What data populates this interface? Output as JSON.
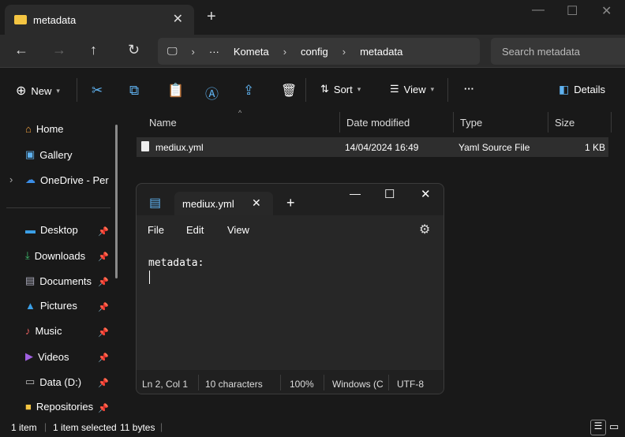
{
  "window": {
    "tab_title": "metadata"
  },
  "address": {
    "crumbs": [
      "Kometa",
      "config",
      "metadata"
    ],
    "ellipsis": "···",
    "search_placeholder": "Search metadata"
  },
  "toolbar": {
    "new": "New",
    "sort": "Sort",
    "view": "View",
    "more": "···",
    "details": "Details"
  },
  "sidebar": {
    "items": [
      {
        "label": "Home",
        "icon": "home-icon"
      },
      {
        "label": "Gallery",
        "icon": "gallery-icon"
      },
      {
        "label": "OneDrive - Personal",
        "icon": "cloud-icon"
      },
      {
        "label": "Desktop",
        "icon": "desktop-icon"
      },
      {
        "label": "Downloads",
        "icon": "download-icon"
      },
      {
        "label": "Documents",
        "icon": "documents-icon"
      },
      {
        "label": "Pictures",
        "icon": "pictures-icon"
      },
      {
        "label": "Music",
        "icon": "music-icon"
      },
      {
        "label": "Videos",
        "icon": "videos-icon"
      },
      {
        "label": "Data (D:)",
        "icon": "drive-icon"
      },
      {
        "label": "Repositories",
        "icon": "folder-icon"
      }
    ]
  },
  "columns": [
    "Name",
    "Date modified",
    "Type",
    "Size"
  ],
  "files": [
    {
      "name": "mediux.yml",
      "date": "14/04/2024 16:49",
      "type": "Yaml Source File",
      "size": "1 KB"
    }
  ],
  "status": {
    "count": "1 item",
    "selected": "1 item selected",
    "size": "11 bytes"
  },
  "notepad": {
    "tab": "mediux.yml",
    "menu": [
      "File",
      "Edit",
      "View"
    ],
    "content": "metadata:",
    "status": {
      "position": "Ln 2, Col 1",
      "chars": "10 characters",
      "zoom": "100%",
      "line_ending": "Windows (C",
      "encoding": "UTF-8"
    }
  },
  "colors": {
    "accent": "#5fb2f0",
    "folder": "#f4c542"
  }
}
